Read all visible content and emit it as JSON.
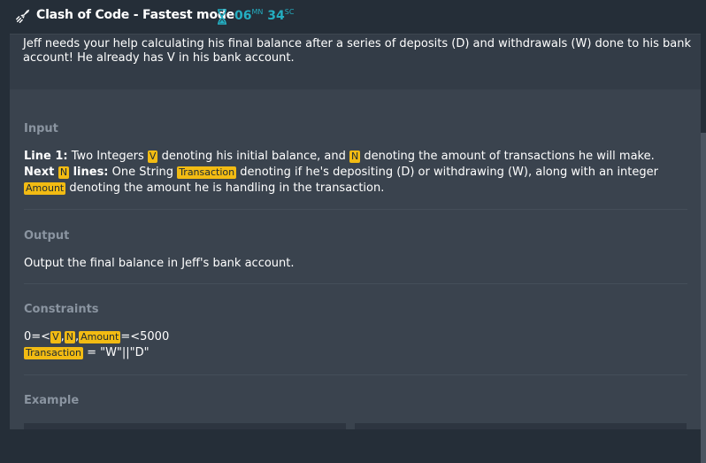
{
  "header": {
    "title": "Clash of Code - Fastest mode",
    "timer_minutes": "06",
    "timer_minutes_unit": "MN",
    "timer_seconds": "34",
    "timer_seconds_unit": "SC",
    "rocket_icon": "rocket-icon",
    "hourglass_icon": "hourglass-icon",
    "accent_color": "#24aec1"
  },
  "statement": {
    "text": "Jeff needs your help calculating his final balance after a series of deposits (D) and withdrawals (W) done to his bank account! He already has V in his bank account."
  },
  "input": {
    "title": "Input",
    "line1_label": "Line 1:",
    "line1_text_a": " Two Integers ",
    "var_v": "V",
    "line1_text_b": " denoting his initial balance, and ",
    "var_n": "N",
    "line1_text_c": " denoting the amount of transactions he will make.",
    "next_label": "Next ",
    "lines_label": " lines:",
    "line2_text_a": " One String ",
    "var_transaction": "Transaction",
    "line2_text_b": " denoting if he's depositing (D) or withdrawing (W), along with an integer",
    "var_amount": "Amount",
    "line3_text": " denoting the amount he is handling in the transaction."
  },
  "output": {
    "title": "Output",
    "text": "Output the final balance in Jeff's bank account."
  },
  "constraints": {
    "title": "Constraints",
    "prefix": "0=<",
    "sep1": ",",
    "sep2": ",",
    "suffix": "=<5000",
    "transaction_rule": " = \"W\"||\"D\""
  },
  "example": {
    "title": "Example"
  },
  "colors": {
    "variable_highlight": "#f2bb13",
    "background": "#252e38",
    "panel": "#3a434e"
  }
}
